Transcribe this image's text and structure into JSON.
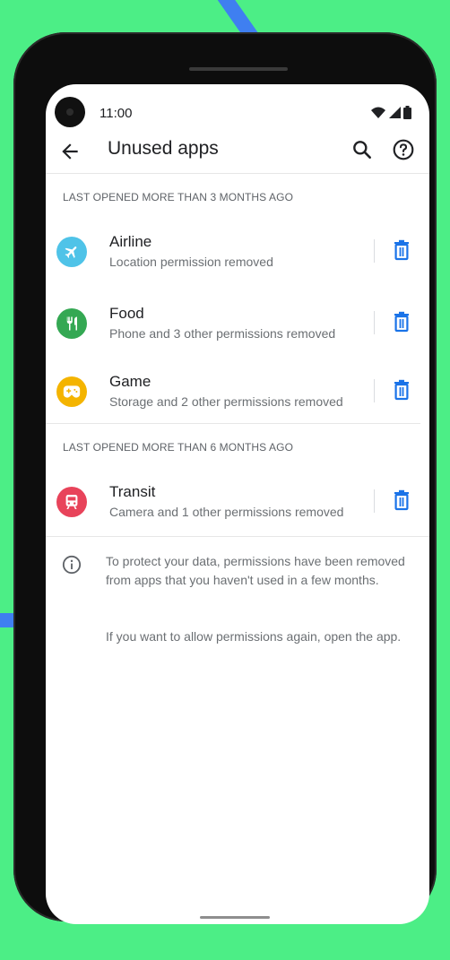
{
  "status_bar": {
    "time": "11:00"
  },
  "appbar": {
    "title": "Unused apps"
  },
  "sections": [
    {
      "header": "LAST OPENED MORE THAN 3 MONTHS AGO",
      "apps": [
        {
          "name": "Airline",
          "subtitle": "Location permission removed",
          "icon": "airplane-icon",
          "color": "#4fc3e8"
        },
        {
          "name": "Food",
          "subtitle": "Phone and 3 other permissions removed",
          "icon": "fork-knife-icon",
          "color": "#34a853"
        },
        {
          "name": "Game",
          "subtitle": "Storage and 2 other permissions removed",
          "icon": "gamepad-icon",
          "color": "#f4b400"
        }
      ]
    },
    {
      "header": "LAST OPENED MORE THAN 6 MONTHS AGO",
      "apps": [
        {
          "name": "Transit",
          "subtitle": "Camera and 1 other permissions removed",
          "icon": "train-icon",
          "color": "#e8435a"
        }
      ]
    }
  ],
  "info": {
    "line1": "To protect your data, permissions have been removed from  apps that you haven't used in a few months.",
    "line2": "If you want to allow permissions again, open the app."
  },
  "colors": {
    "background": "#4cee86",
    "accent_blue": "#1a73e8"
  }
}
